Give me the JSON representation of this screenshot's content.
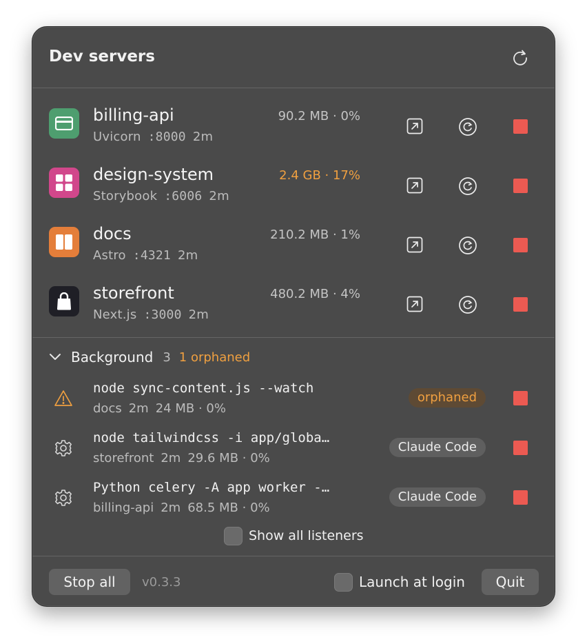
{
  "header": {
    "title": "Dev servers",
    "refresh_icon": "refresh-icon"
  },
  "servers": [
    {
      "name": "billing-api",
      "framework": "Uvicorn",
      "port": ":8000",
      "uptime": "2m",
      "usage": "90.2 MB · 0%",
      "icon": "credit-card-icon",
      "icon_color": "#4e9e6f",
      "warn": false
    },
    {
      "name": "design-system",
      "framework": "Storybook",
      "port": ":6006",
      "uptime": "2m",
      "usage": "2.4 GB · 17%",
      "icon": "grid-icon",
      "icon_color": "#d1478b",
      "warn": true
    },
    {
      "name": "docs",
      "framework": "Astro",
      "port": ":4321",
      "uptime": "2m",
      "usage": "210.2 MB · 1%",
      "icon": "book-icon",
      "icon_color": "#e47e3a",
      "warn": false
    },
    {
      "name": "storefront",
      "framework": "Next.js",
      "port": ":3000",
      "uptime": "2m",
      "usage": "480.2 MB · 4%",
      "icon": "shopping-bag-icon",
      "icon_color": "#1f1f26",
      "warn": false
    }
  ],
  "background": {
    "title": "Background",
    "count": "3",
    "orphaned_label": "1 orphaned",
    "processes": [
      {
        "command": "node sync-content.js --watch",
        "project": "docs",
        "uptime": "2m",
        "usage": "24 MB · 0%",
        "badge": "orphaned",
        "icon": "warning-icon"
      },
      {
        "command": "node tailwindcss -i app/globa…",
        "project": "storefront",
        "uptime": "2m",
        "usage": "29.6 MB · 0%",
        "badge": "Claude Code",
        "icon": "gear-icon"
      },
      {
        "command": "Python celery -A app worker -…",
        "project": "billing-api",
        "uptime": "2m",
        "usage": "68.5 MB · 0%",
        "badge": "Claude Code",
        "icon": "gear-icon"
      }
    ],
    "show_all_label": "Show all listeners"
  },
  "footer": {
    "stop_all_label": "Stop all",
    "version": "v0.3.3",
    "launch_label": "Launch at login",
    "quit_label": "Quit"
  },
  "colors": {
    "stop": "#ec5a52",
    "warn": "#f0a040",
    "panel": "#4a4a4a"
  }
}
